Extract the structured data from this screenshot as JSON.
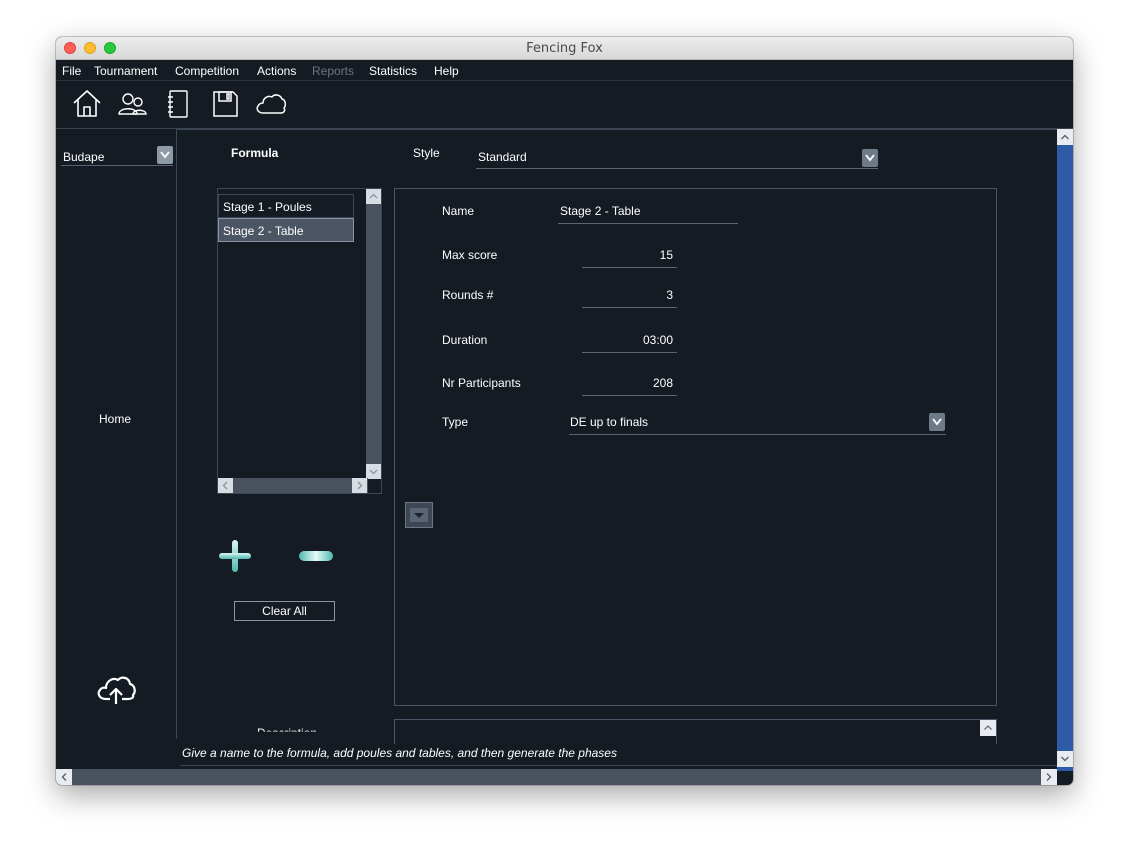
{
  "window": {
    "title": "Fencing Fox"
  },
  "menu": {
    "file": "File",
    "tournament": "Tournament",
    "competition": "Competition",
    "actions": "Actions",
    "reports": "Reports",
    "statistics": "Statistics",
    "help": "Help"
  },
  "toolbar": {
    "icons": [
      "home-icon",
      "people-icon",
      "notebook-icon",
      "save-icon",
      "cloud-icon"
    ]
  },
  "sidebar": {
    "selector_value": "Budape",
    "home_label": "Home",
    "upload_icon": "cloud-upload-icon"
  },
  "formula": {
    "heading": "Formula",
    "style_label": "Style",
    "style_value": "Standard",
    "stages": [
      {
        "label": "Stage 1 - Poules",
        "selected": false
      },
      {
        "label": "Stage 2 - Table",
        "selected": true
      }
    ],
    "clear_all_label": "Clear All",
    "add_icon": "plus-icon",
    "remove_icon": "minus-icon"
  },
  "details": {
    "name_label": "Name",
    "name_value": "Stage 2 - Table",
    "max_score_label": "Max score",
    "max_score_value": "15",
    "rounds_label": "Rounds #",
    "rounds_value": "3",
    "duration_label": "Duration",
    "duration_value": "03:00",
    "participants_label": "Nr Participants",
    "participants_value": "208",
    "type_label": "Type",
    "type_value": "DE up to finals"
  },
  "description_label": "Description",
  "status": {
    "hint": "Give a name to the formula, add poules and tables, and then generate the phases"
  },
  "colors": {
    "background": "#151b23",
    "scrollbar_accent": "#2f5aa8",
    "selection": "#4b5563"
  }
}
